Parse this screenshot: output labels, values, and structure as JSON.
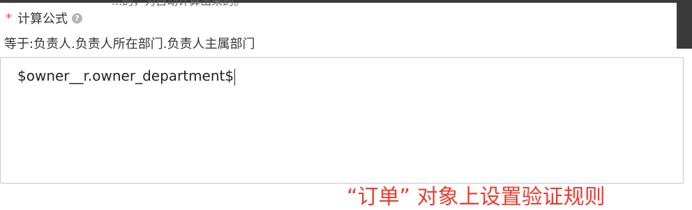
{
  "header": {
    "cut_text": "...的，为自动计算出来的。"
  },
  "field": {
    "required_mark": "*",
    "label": "计算公式",
    "help_icon": "?"
  },
  "formula": {
    "description": "等于:负责人.负责人所在部门.负责人主属部门",
    "value": "$owner__r.owner_department$"
  },
  "annotation": {
    "text": "“订单” 对象上设置验证规则"
  },
  "colors": {
    "required": "#e74c3c",
    "annotation": "#ee3b2d",
    "border": "#c6c6c6"
  }
}
